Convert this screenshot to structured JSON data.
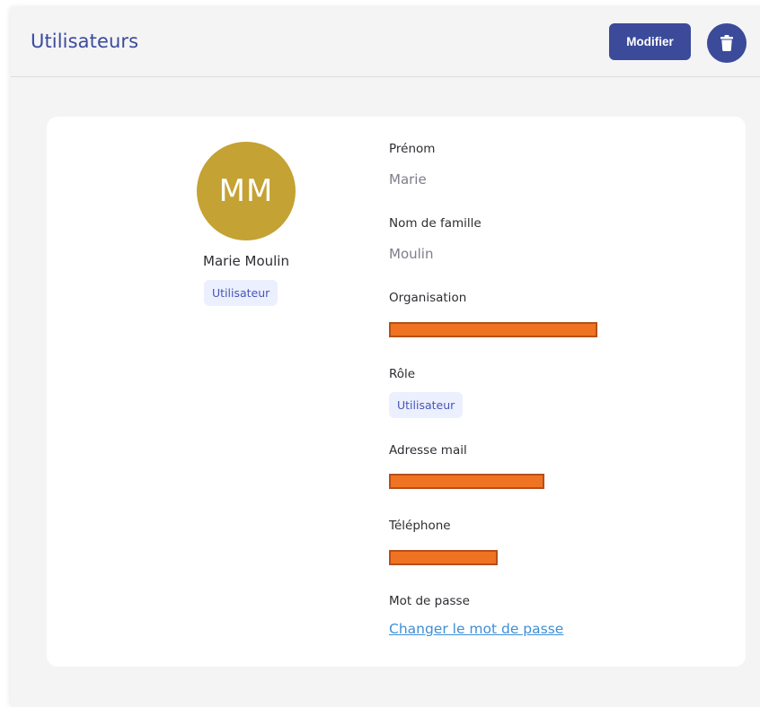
{
  "header": {
    "title": "Utilisateurs",
    "edit_label": "Modifier",
    "delete_icon": "trash-icon"
  },
  "profile": {
    "initials": "MM",
    "full_name": "Marie Moulin",
    "badge": "Utilisateur",
    "avatar_color": "#c4a233"
  },
  "fields": {
    "first_name_label": "Prénom",
    "first_name_value": "Marie",
    "last_name_label": "Nom de famille",
    "last_name_value": "Moulin",
    "organisation_label": "Organisation",
    "role_label": "Rôle",
    "role_value": "Utilisateur",
    "email_label": "Adresse mail",
    "phone_label": "Téléphone",
    "password_label": "Mot de passe",
    "password_link": "Changer le mot de passe"
  },
  "colors": {
    "accent": "#3c4a9a",
    "link": "#3d8fd8",
    "redaction": "#ef7322",
    "badge_bg": "#eceffd"
  }
}
